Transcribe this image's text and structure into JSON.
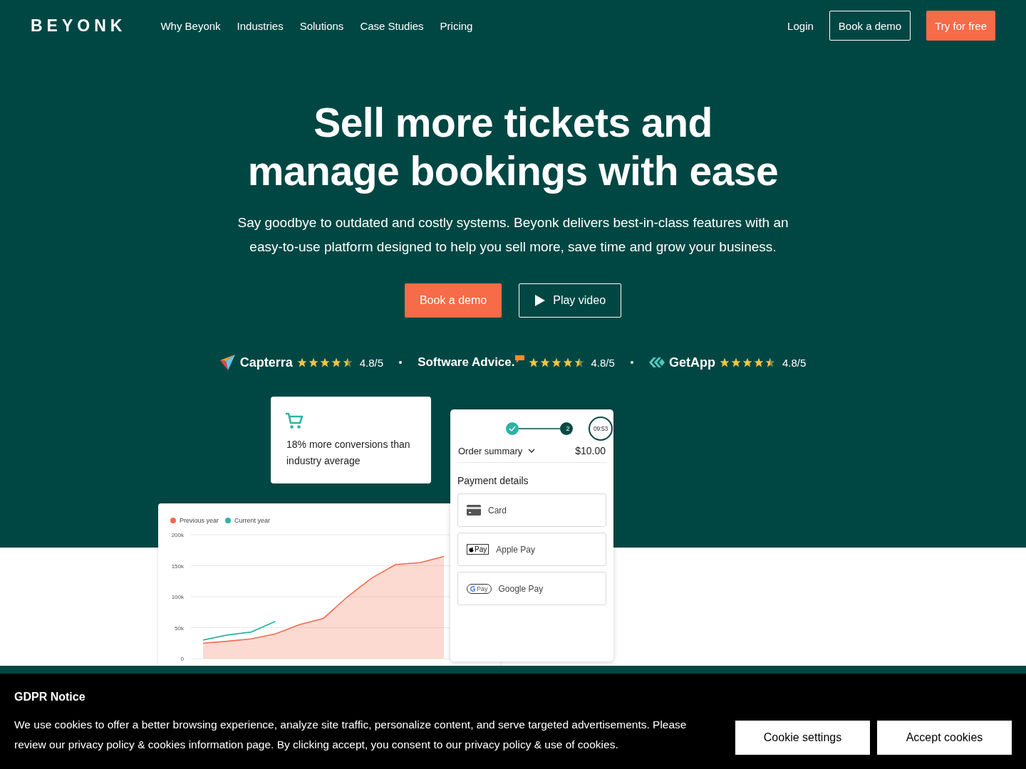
{
  "nav": {
    "logo": "BEYONK",
    "links": [
      "Why Beyonk",
      "Industries",
      "Solutions",
      "Case Studies",
      "Pricing"
    ],
    "login": "Login",
    "demo_button": "Book a demo",
    "trial_button": "Try for free"
  },
  "hero": {
    "title": "Sell more tickets and manage bookings with ease",
    "subtitle": "Say goodbye to outdated and costly systems. Beyonk delivers best-in-class features with an easy-to-use platform designed to help you sell more, save time and grow your business.",
    "primary_button": "Book a demo",
    "video_button": "Play video"
  },
  "ratings": [
    {
      "kind": "capterra",
      "name": "Capterra",
      "stars": 4.5,
      "score": "4.8/5"
    },
    {
      "kind": "softwareadvice",
      "name": "Software Advice.",
      "stars": 4.5,
      "score": "4.8/5"
    },
    {
      "kind": "getapp",
      "name": "GetApp",
      "stars": 4.5,
      "score": "4.8/5"
    }
  ],
  "stat_card": {
    "text": "18% more conversions than industry average"
  },
  "chart": {
    "chart_data": {
      "type": "line",
      "grid": true,
      "yticks": [
        {
          "value": 0,
          "label": "0"
        },
        {
          "value": 50000,
          "label": "50k"
        },
        {
          "value": 100000,
          "label": "100k"
        },
        {
          "value": 150000,
          "label": "150k"
        },
        {
          "value": 200000,
          "label": "200k"
        }
      ],
      "ylim": [
        0,
        200000
      ],
      "series": [
        {
          "name": "Previous year",
          "type": "area",
          "color": "#f26b4b",
          "values": [
            25000,
            28000,
            32000,
            40000,
            55000,
            65000,
            100000,
            130000,
            152000,
            155000,
            165000,
            null
          ]
        },
        {
          "name": "Current year",
          "type": "line",
          "color": "#2bb3a3",
          "values": [
            30000,
            38000,
            43000,
            60000,
            null,
            null,
            null,
            null,
            null,
            null,
            null,
            null
          ]
        }
      ]
    }
  },
  "checkout": {
    "timer": "09:53",
    "step": "2",
    "order_label": "Order summary",
    "amount": "$10.00",
    "payment_heading": "Payment details",
    "methods": [
      {
        "kind": "card",
        "label": "Card"
      },
      {
        "kind": "applepay",
        "badge": "Pay",
        "label": "Apple Pay"
      },
      {
        "kind": "googlepay",
        "badge": "Pay",
        "label": "Google Pay"
      }
    ]
  },
  "cookie_banner": {
    "title": "GDPR Notice",
    "text": "We use cookies to offer a better browsing experience, analyze site traffic, personalize content, and serve targeted advertisements. Please review our privacy policy & cookies information page. By clicking accept, you consent to our privacy policy & use of cookies.",
    "settings_button": "Cookie settings",
    "accept_button": "Accept cookies"
  }
}
